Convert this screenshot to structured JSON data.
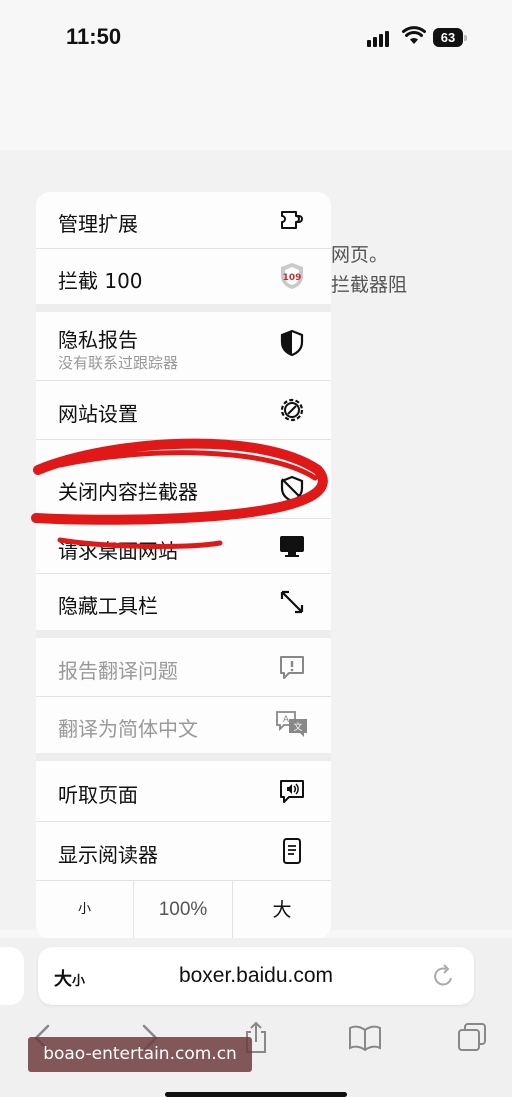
{
  "status": {
    "time": "11:50",
    "battery": "63"
  },
  "background_text": {
    "line1": "网页。",
    "line2": "拦截器阻"
  },
  "menu": {
    "items": [
      {
        "label": "管理扩展",
        "icon": "extension-icon",
        "disabled": false
      },
      {
        "label": "拦截 100",
        "icon": "blocker-shield-badge-icon",
        "disabled": false
      },
      {
        "label": "隐私报告",
        "sublabel": "没有联系过跟踪器",
        "icon": "privacy-shield-icon",
        "disabled": false
      },
      {
        "label": "网站设置",
        "icon": "settings-gear-icon",
        "disabled": false
      },
      {
        "label": "关闭内容拦截器",
        "icon": "shield-slash-icon",
        "disabled": false
      },
      {
        "label": "请求桌面网站",
        "icon": "desktop-icon",
        "disabled": false
      },
      {
        "label": "隐藏工具栏",
        "icon": "expand-arrows-icon",
        "disabled": false
      },
      {
        "label": "报告翻译问题",
        "icon": "report-bubble-icon",
        "disabled": true
      },
      {
        "label": "翻译为简体中文",
        "icon": "translate-icon",
        "disabled": true
      },
      {
        "label": "听取页面",
        "icon": "speaker-bubble-icon",
        "disabled": false
      },
      {
        "label": "显示阅读器",
        "icon": "reader-icon",
        "disabled": false
      }
    ],
    "zoom": {
      "smaller": "小",
      "level": "100%",
      "larger": "大"
    }
  },
  "urlbar": {
    "aa_big": "大",
    "aa_small": "小",
    "url": "boxer.baidu.com"
  },
  "toolbar": {
    "icons": [
      "back-icon",
      "forward-icon",
      "share-icon",
      "bookmarks-icon",
      "tabs-icon"
    ]
  },
  "watermark": "boao-entertain.com.cn"
}
